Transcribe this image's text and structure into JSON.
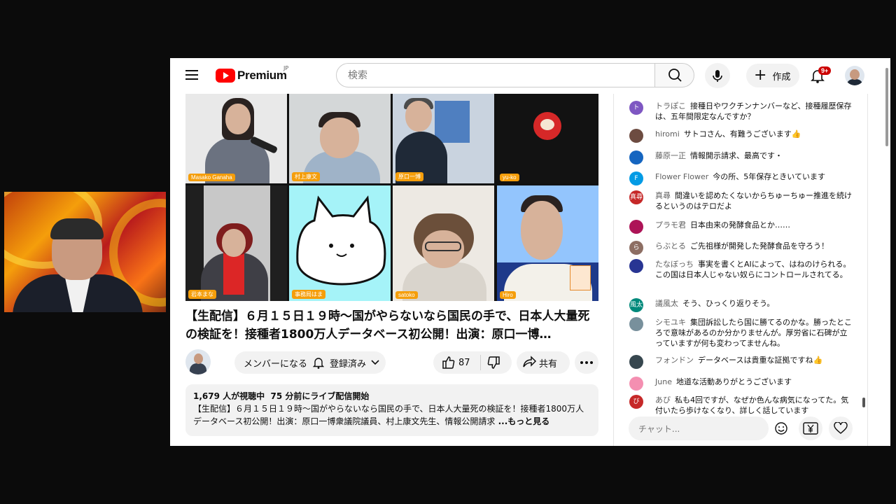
{
  "brand": {
    "name": "Premium",
    "region": "JP"
  },
  "search": {
    "placeholder": "検索"
  },
  "header": {
    "create_label": "作成",
    "notification_count": "9+"
  },
  "video": {
    "participants": [
      "Masako Ganaha",
      "村上康文",
      "原口一博",
      "yu-ko",
      "岩本まな",
      "事務局はま",
      "satoko",
      "Hiro"
    ],
    "title": "【生配信】６月１５日１９時〜国がやらないなら国民の手で、日本人大量死の検証を！接種者1800万人データベース初公開！出演：原口一博…",
    "member_label": "メンバーになる",
    "subscribed_label": "登録済み",
    "like_count": "87",
    "share_label": "共有",
    "description": {
      "viewers": "1,679 人が視聴中",
      "started": "75 分前にライブ配信開始",
      "text": "【生配信】６月１５日１９時〜国がやらないなら国民の手で、日本人大量死の検証を！接種者1800万人データベース初公開！出演：原口一博衆議院議員、村上康文先生、情報公開請求",
      "more": " ...もっと見る"
    }
  },
  "chat": {
    "messages": [
      {
        "author": "トラぽこ",
        "text": "接種日やワクチンナンバーなど、接種履歴保存は、五年間限定なんですか？",
        "avatar": "ト",
        "color": "#7e57c2"
      },
      {
        "author": "hiromi",
        "text": "サトコさん、有難うございます👍",
        "avatar": "",
        "color": "#6d4c41"
      },
      {
        "author": "藤原一正",
        "text": "情報開示請求、最高です・",
        "avatar": "",
        "color": "#1565c0"
      },
      {
        "author": "Flower Flower",
        "text": "今の所、5年保存ときいています",
        "avatar": "F",
        "color": "#039be5"
      },
      {
        "author": "真尋",
        "text": "間違いを認めたくないからちゅーちゅー推進を続けるというのはテロだよ",
        "avatar": "真尋",
        "color": "#c62828"
      },
      {
        "author": "プラモ君",
        "text": "日本由来の発酵食品とか……",
        "avatar": "",
        "color": "#ad1457"
      },
      {
        "author": "らぶとる",
        "text": "ご先祖様が開発した発酵食品を守ろう！",
        "avatar": "ら",
        "color": "#8d6e63"
      },
      {
        "author": "たなぼっち",
        "text": "事実を書くとAIによって、はねのけられる。この国は日本人じゃない奴らにコントロールされてる。",
        "avatar": "",
        "color": "#283593"
      },
      {
        "author": "議風太",
        "text": "そう、ひっくり返りそう。",
        "avatar": "風太",
        "color": "#00897b"
      },
      {
        "author": "シモユキ",
        "text": "集団訴訟したら国に勝てるのかな。勝ったところで意味があるのか分かりませんが。厚労省に石碑が立っていますが何も変わってませんね。",
        "avatar": "",
        "color": "#78909c"
      },
      {
        "author": "フォンドン",
        "text": "データベースは貴重な証拠ですね👍",
        "avatar": "",
        "color": "#37474f"
      },
      {
        "author": "June",
        "text": "地道な活動ありがとうございます",
        "avatar": "",
        "color": "#f48fb1"
      },
      {
        "author": "あび",
        "text": "私も4回ですが、なぜか色んな病気になってた。気付いたら歩けなくなり、詳しく話しています",
        "avatar": "び",
        "color": "#c62828"
      }
    ],
    "input_placeholder": "チャット..."
  }
}
